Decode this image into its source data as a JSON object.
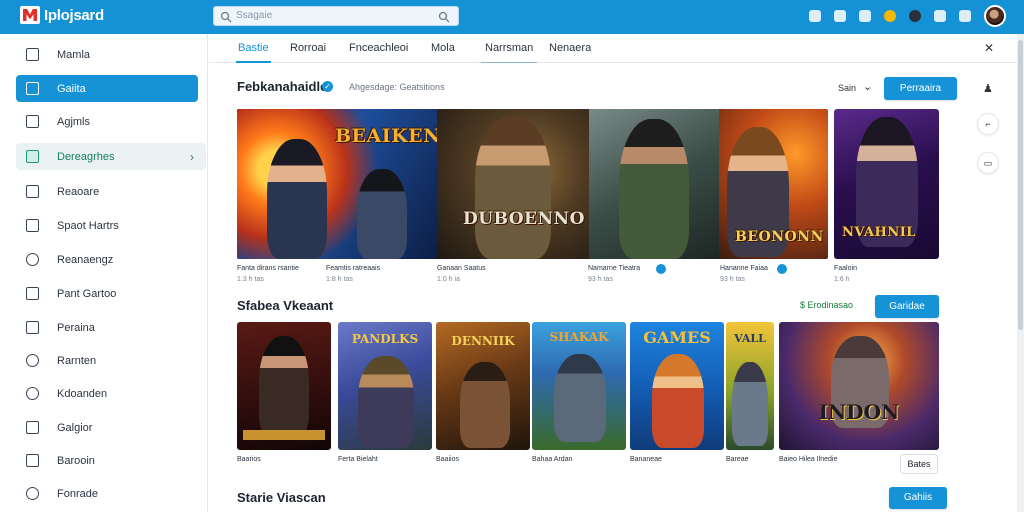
{
  "app": {
    "logo_text": "Iplojsard",
    "search_placeholder": "Ssagaie"
  },
  "sidebar": {
    "items": [
      {
        "label": "Mamla"
      },
      {
        "label": "Gaiita"
      },
      {
        "label": "Agjmls"
      },
      {
        "label": "Dereagrhes"
      },
      {
        "label": "Reaoare"
      },
      {
        "label": "Spaot Hartrs"
      },
      {
        "label": "Reanaengz"
      },
      {
        "label": "Pant Gartoo"
      },
      {
        "label": "Peraina"
      },
      {
        "label": "Rarnten"
      },
      {
        "label": "Kdoanden"
      },
      {
        "label": "Galgior"
      },
      {
        "label": "Barooin"
      },
      {
        "label": "Fonrade"
      }
    ]
  },
  "tabs": [
    {
      "label": "Bastie"
    },
    {
      "label": "Rorroai"
    },
    {
      "label": "Fnceachleoi"
    },
    {
      "label": "Mola"
    },
    {
      "label": "Narrsman"
    },
    {
      "label": "Nenaera"
    }
  ],
  "featured": {
    "title": "Febkanahaidle",
    "subtitle": "Ahgesdage: Geatsitions",
    "sort_label": "Sain",
    "button": "Perraaira",
    "banner_titles": [
      "BEAIKENS",
      "DUBOENNO",
      "BEONONN"
    ],
    "card_title": "NVAHNIL",
    "captions": [
      {
        "title": "Fanta dirans rsantie",
        "meta": "1:3 h  tas"
      },
      {
        "title": "Feamtis ratreaais",
        "meta": "1:8 h  tas"
      },
      {
        "title": "Ganaan Saatus",
        "meta": "1:0 h  ia"
      },
      {
        "title": "Namarne Tieatra",
        "meta": "93 h  tas"
      },
      {
        "title": "Hananne Faiaa",
        "meta": "93 h  tas"
      },
      {
        "title": "Faaloin",
        "meta": "1:6 h"
      }
    ]
  },
  "section2": {
    "title": "Sfabea Vkeaant",
    "link": "Erodinasao",
    "button": "Garidae",
    "cards": [
      {
        "art": "",
        "title": "Baarios"
      },
      {
        "art": "PANDLKS",
        "title": "Ferta Bielaht"
      },
      {
        "art": "DENNIIK",
        "title": "Baaiios"
      },
      {
        "art": "SHAKAK",
        "title": "Bahaa Ardan"
      },
      {
        "art": "GAMES",
        "title": "Bananeae"
      },
      {
        "art": "VALL",
        "title": "Bareae"
      },
      {
        "art": "INDON",
        "title": "Baieo Hilea Ilnedie"
      }
    ],
    "more_button": "Bates"
  },
  "section3": {
    "title": "Starie Viascan",
    "button": "Gahiis"
  }
}
